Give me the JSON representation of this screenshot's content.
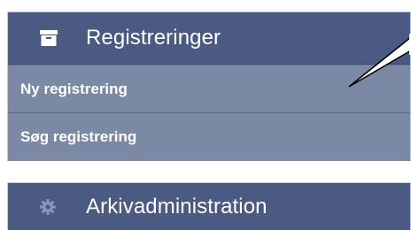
{
  "panels": [
    {
      "title": "Registreringer",
      "icon": "archive-box-icon",
      "items": [
        {
          "label": "Ny registrering"
        },
        {
          "label": "Søg registrering"
        }
      ]
    },
    {
      "title": "Arkivadministration",
      "icon": "gear-icon"
    }
  ],
  "colors": {
    "header_bg": "#4a5a82",
    "item_bg": "#7c89a4",
    "text": "#ffffff"
  }
}
